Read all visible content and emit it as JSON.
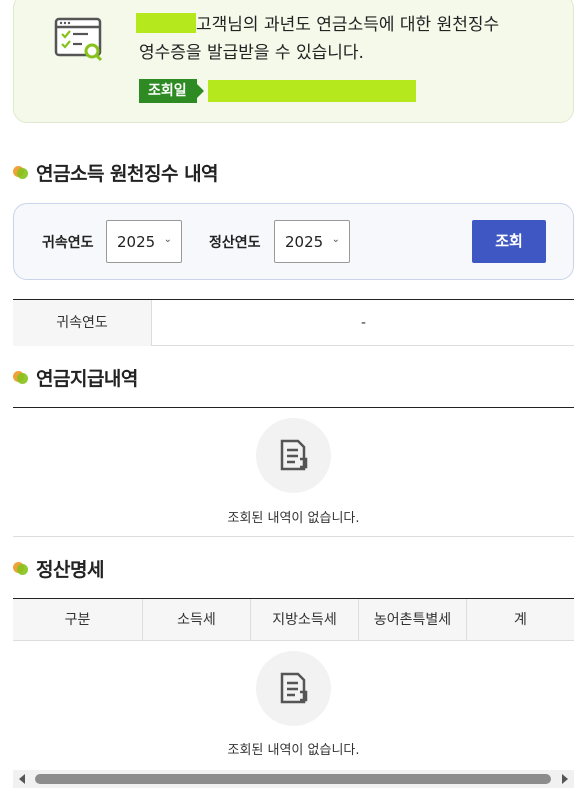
{
  "notice": {
    "line1_suffix": "고객님의 과년도 연금소득에 대한 원천징수",
    "line2": "영수증을 발급받을 수 있습니다.",
    "date_tag": "조회일"
  },
  "sections": {
    "withholding": "연금소득 원천징수 내역",
    "payment": "연금지급내역",
    "settlement": "정산명세"
  },
  "search": {
    "attribution_year_label": "귀속연도",
    "attribution_year_value": "2025",
    "settlement_year_label": "정산연도",
    "settlement_year_value": "2025",
    "search_button": "조회"
  },
  "year_table": {
    "header": "귀속연도",
    "value": "-"
  },
  "empty_message": "조회된 내역이 없습니다.",
  "settlement_table": {
    "columns": [
      "구분",
      "소득세",
      "지방소득세",
      "농어촌특별세",
      "계"
    ]
  },
  "colors": {
    "accent_blue": "#3f57c3",
    "tag_green": "#2e8b23",
    "mask_highlight": "#b6e81e"
  },
  "icons": {
    "notice": "document-check-search-icon",
    "empty": "document-icon"
  }
}
